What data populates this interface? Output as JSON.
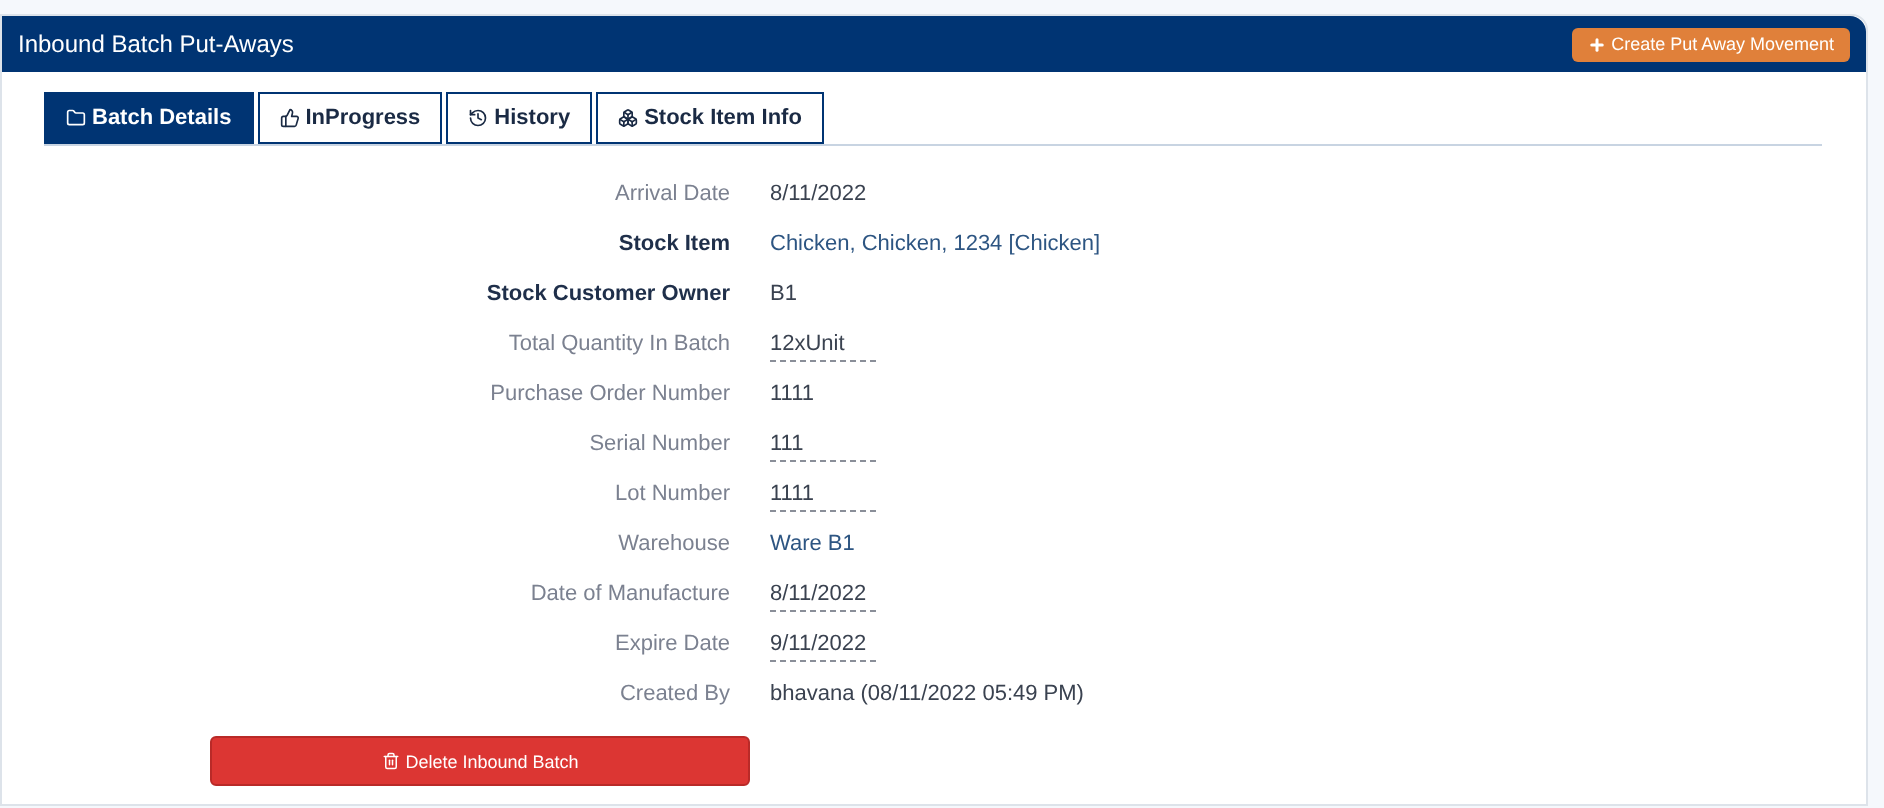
{
  "header": {
    "title": "Inbound Batch Put-Aways",
    "action": "Create Put Away Movement"
  },
  "tabs": [
    {
      "label": "Batch Details",
      "kind": "folder",
      "selected": true
    },
    {
      "label": "InProgress",
      "kind": "thumb",
      "selected": false
    },
    {
      "label": "History",
      "kind": "history",
      "selected": false
    },
    {
      "label": "Stock Item Info",
      "kind": "box",
      "selected": false
    }
  ],
  "fields": [
    {
      "label": "Arrival Date",
      "value": "8/11/2022",
      "strong": false,
      "link": false,
      "editable": false
    },
    {
      "label": "Stock Item",
      "value": "Chicken, Chicken, 1234 [Chicken]",
      "strong": true,
      "link": true,
      "editable": false
    },
    {
      "label": "Stock Customer Owner",
      "value": "B1",
      "strong": true,
      "link": false,
      "editable": false
    },
    {
      "label": "Total Quantity In Batch",
      "value": "12xUnit",
      "strong": false,
      "link": false,
      "editable": true
    },
    {
      "label": "Purchase Order Number",
      "value": "1111",
      "strong": false,
      "link": false,
      "editable": false
    },
    {
      "label": "Serial Number",
      "value": "111",
      "strong": false,
      "link": false,
      "editable": true
    },
    {
      "label": "Lot Number",
      "value": "1111",
      "strong": false,
      "link": false,
      "editable": true
    },
    {
      "label": "Warehouse",
      "value": "Ware B1",
      "strong": false,
      "link": true,
      "editable": false
    },
    {
      "label": "Date of Manufacture",
      "value": "8/11/2022",
      "strong": false,
      "link": false,
      "editable": true
    },
    {
      "label": "Expire Date",
      "value": "9/11/2022",
      "strong": false,
      "link": false,
      "editable": true
    },
    {
      "label": "Created By",
      "value": "bhavana (08/11/2022 05:49 PM)",
      "strong": false,
      "link": false,
      "editable": false
    }
  ],
  "delete_button": "Delete Inbound Batch"
}
